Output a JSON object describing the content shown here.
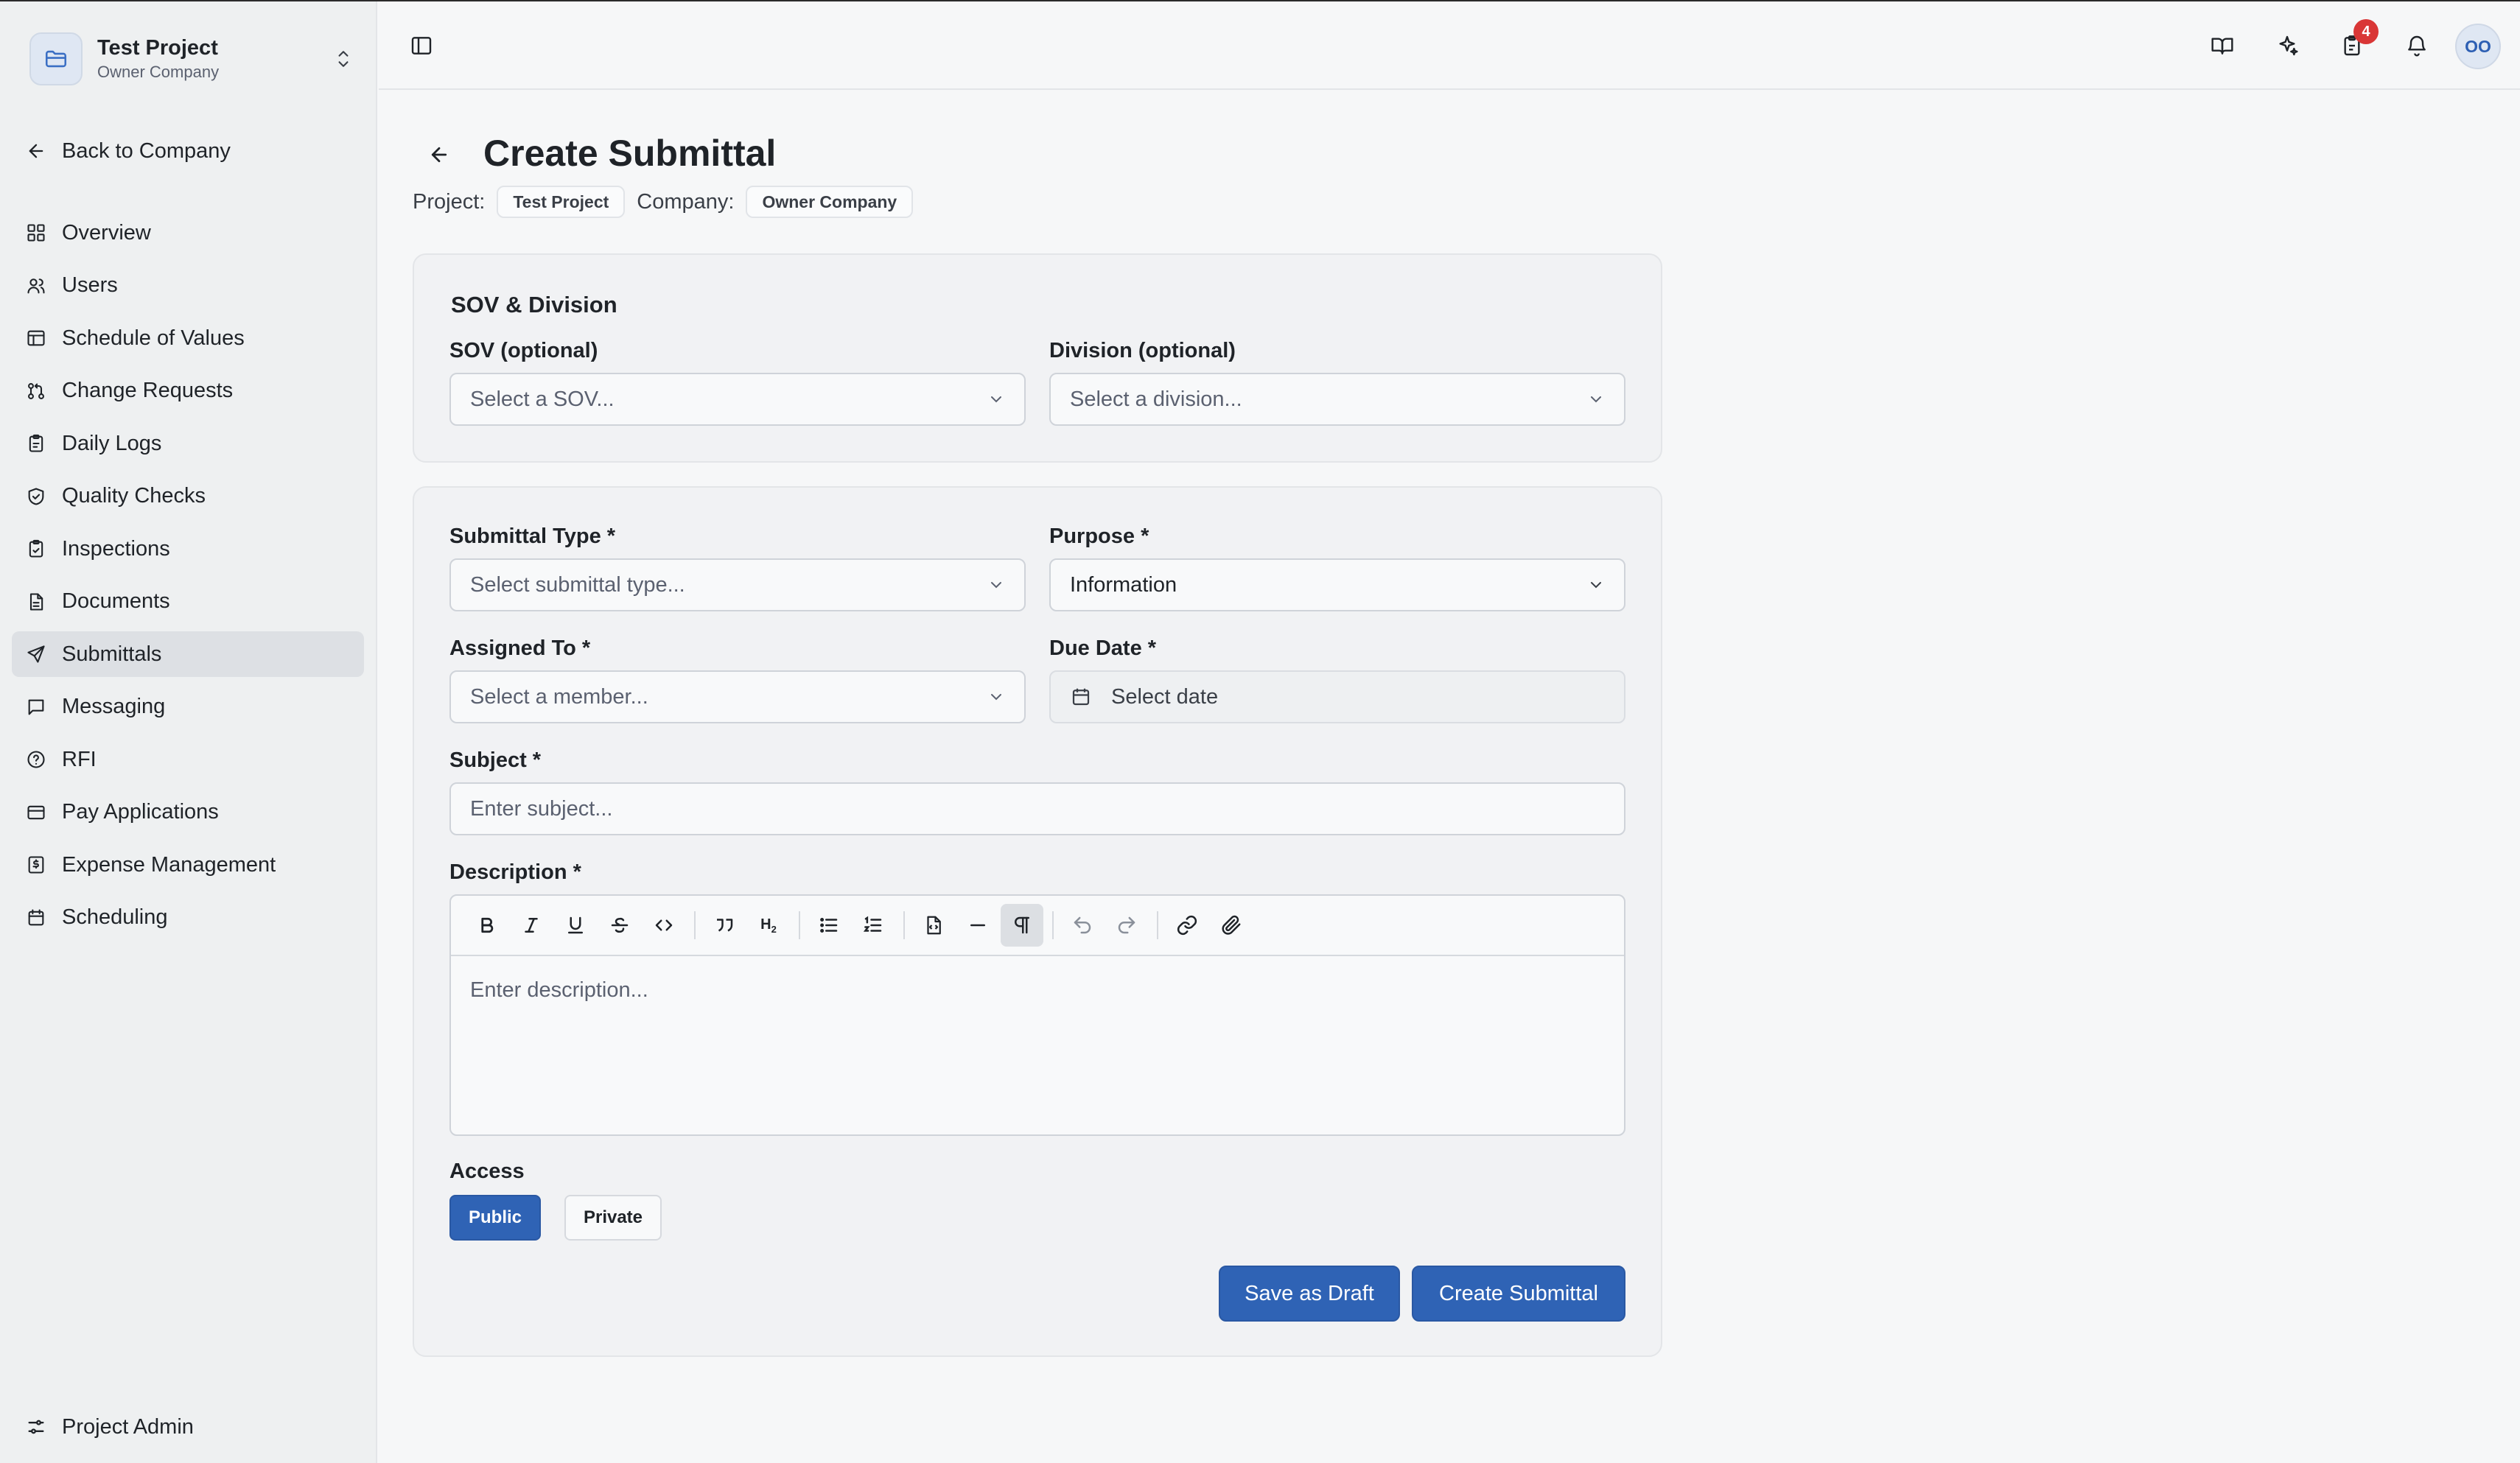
{
  "project": {
    "name": "Test Project",
    "company": "Owner Company"
  },
  "sidebar": {
    "back": "Back to Company",
    "items": [
      {
        "label": "Overview",
        "icon": "grid-icon"
      },
      {
        "label": "Users",
        "icon": "users-icon"
      },
      {
        "label": "Schedule of Values",
        "icon": "table-icon"
      },
      {
        "label": "Change Requests",
        "icon": "git-pull-icon"
      },
      {
        "label": "Daily Logs",
        "icon": "clipboard-icon"
      },
      {
        "label": "Quality Checks",
        "icon": "shield-check-icon"
      },
      {
        "label": "Inspections",
        "icon": "clipboard-check-icon"
      },
      {
        "label": "Documents",
        "icon": "file-text-icon"
      },
      {
        "label": "Submittals",
        "icon": "send-icon",
        "active": true
      },
      {
        "label": "Messaging",
        "icon": "message-square-icon"
      },
      {
        "label": "RFI",
        "icon": "help-circle-icon"
      },
      {
        "label": "Pay Applications",
        "icon": "credit-card-icon"
      },
      {
        "label": "Expense Management",
        "icon": "receipt-icon"
      },
      {
        "label": "Scheduling",
        "icon": "calendar-icon"
      }
    ],
    "footer": "Project Admin"
  },
  "header": {
    "notification_count": "4",
    "avatar_initials": "OO"
  },
  "page": {
    "title": "Create Submittal",
    "project_label": "Project:",
    "project_value": "Test Project",
    "company_label": "Company:",
    "company_value": "Owner Company"
  },
  "sov_section": {
    "title": "SOV & Division",
    "sov_label": "SOV (optional)",
    "sov_placeholder": "Select a SOV...",
    "division_label": "Division (optional)",
    "division_placeholder": "Select a division..."
  },
  "form": {
    "type_label": "Submittal Type *",
    "type_placeholder": "Select submittal type...",
    "purpose_label": "Purpose *",
    "purpose_value": "Information",
    "assigned_label": "Assigned To *",
    "assigned_placeholder": "Select a member...",
    "due_label": "Due Date *",
    "due_placeholder": "Select date",
    "subject_label": "Subject *",
    "subject_placeholder": "Enter subject...",
    "description_label": "Description *",
    "description_placeholder": "Enter description...",
    "access_label": "Access",
    "access_public": "Public",
    "access_private": "Private",
    "access_selected": "Public",
    "save_draft": "Save as Draft",
    "create": "Create Submittal"
  },
  "colors": {
    "accent": "#2f63b5",
    "badge": "#d93636"
  }
}
